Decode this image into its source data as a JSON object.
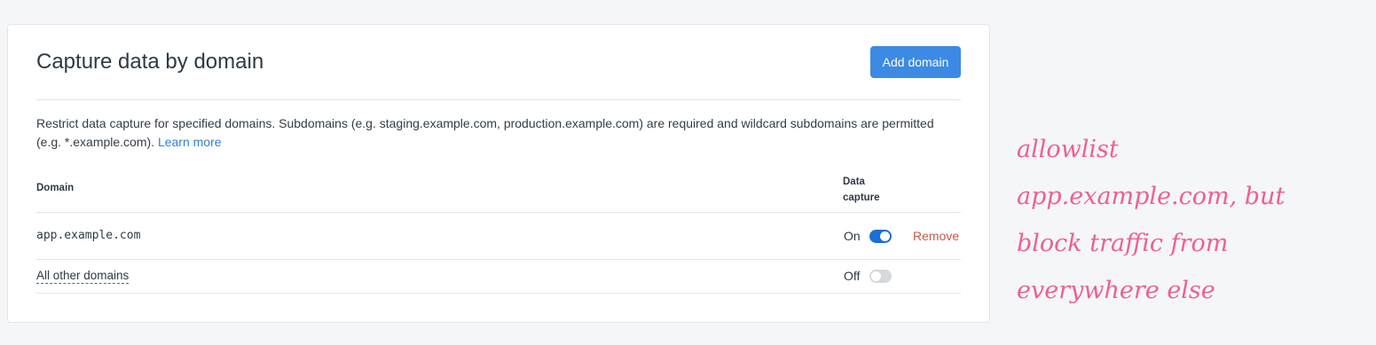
{
  "card": {
    "title": "Capture data by domain",
    "add_button": "Add domain",
    "description": "Restrict data capture for specified domains. Subdomains (e.g. staging.example.com, production.example.com) are required and wildcard subdomains are permitted (e.g. *.example.com).",
    "learn_more": "Learn more"
  },
  "table": {
    "headers": {
      "domain": "Domain",
      "capture_line1": "Data",
      "capture_line2": "capture"
    },
    "rows": [
      {
        "domain": "app.example.com",
        "state": "On",
        "enabled": true,
        "action": "Remove"
      },
      {
        "domain": "All other domains",
        "state": "Off",
        "enabled": false
      }
    ]
  },
  "annotation": {
    "lines": [
      "allowlist",
      "app.example.com, but",
      "block traffic from",
      "everywhere else"
    ]
  },
  "colors": {
    "accent": "#3c8ae3",
    "toggle_on": "#1a6fd8",
    "remove": "#d0554a",
    "annotation": "#ee5f93"
  }
}
